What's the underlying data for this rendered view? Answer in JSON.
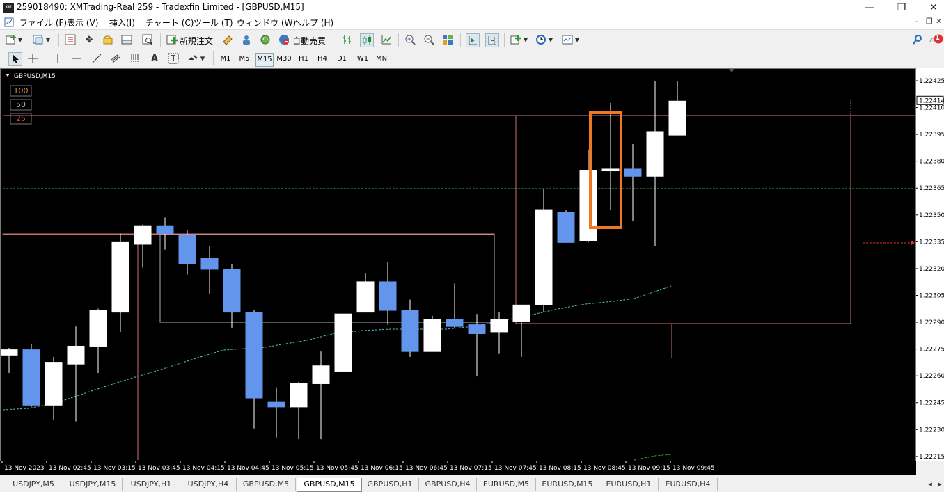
{
  "window": {
    "title": "259018490: XMTrading-Real 259 - Tradexfin Limited - [GBPUSD,M15]",
    "logo": "XM",
    "minimize": "—",
    "maximize": "❐",
    "close": "✕"
  },
  "menu": {
    "items": [
      "ファイル (F)",
      "表示 (V)",
      "挿入(I)",
      "チャート (C)",
      "ツール (T)",
      "ウィンドウ (W)",
      "ヘルプ (H)"
    ],
    "mdi_minimize": "–",
    "mdi_restore": "❐",
    "mdi_close": "✕"
  },
  "toolbar": {
    "new_order": "新規注文",
    "auto_trading": "自動売買",
    "notification_count": "1"
  },
  "timeframes": [
    "M1",
    "M5",
    "M15",
    "M30",
    "H1",
    "H4",
    "D1",
    "W1",
    "MN"
  ],
  "active_timeframe": "M15",
  "chart_data": {
    "type": "candlestick",
    "symbol_label": "GBPUSD,M15",
    "level_boxes": [
      "100",
      "50",
      "25"
    ],
    "level_colors": [
      "#e08a3a",
      "#aaaaaa",
      "#e04040"
    ],
    "current_price": "1.22414",
    "y_ticks": [
      "1.22425",
      "1.22410",
      "1.22395",
      "1.22380",
      "1.22365",
      "1.22350",
      "1.22335",
      "1.22320",
      "1.22305",
      "1.22290",
      "1.22275",
      "1.22260",
      "1.22245",
      "1.22230",
      "1.22215"
    ],
    "ylim": [
      1.22213,
      1.22432
    ],
    "x_ticks": [
      "13 Nov 2023",
      "13 Nov 02:45",
      "13 Nov 03:15",
      "13 Nov 03:45",
      "13 Nov 04:15",
      "13 Nov 04:45",
      "13 Nov 05:15",
      "13 Nov 05:45",
      "13 Nov 06:15",
      "13 Nov 06:45",
      "13 Nov 07:15",
      "13 Nov 07:45",
      "13 Nov 08:15",
      "13 Nov 08:45",
      "13 Nov 09:15",
      "13 Nov 09:45"
    ],
    "candles": [
      {
        "o": 1.22272,
        "h": 1.22276,
        "l": 1.22262,
        "c": 1.22275
      },
      {
        "o": 1.22275,
        "h": 1.22278,
        "l": 1.22243,
        "c": 1.22244
      },
      {
        "o": 1.22244,
        "h": 1.22271,
        "l": 1.22236,
        "c": 1.22268
      },
      {
        "o": 1.22267,
        "h": 1.22288,
        "l": 1.22235,
        "c": 1.22277
      },
      {
        "o": 1.22277,
        "h": 1.22298,
        "l": 1.22262,
        "c": 1.22297
      },
      {
        "o": 1.22296,
        "h": 1.2234,
        "l": 1.22285,
        "c": 1.22335
      },
      {
        "o": 1.22334,
        "h": 1.22345,
        "l": 1.22321,
        "c": 1.22344
      },
      {
        "o": 1.22344,
        "h": 1.22349,
        "l": 1.22331,
        "c": 1.2234
      },
      {
        "o": 1.22339,
        "h": 1.22342,
        "l": 1.22317,
        "c": 1.22323
      },
      {
        "o": 1.22326,
        "h": 1.22333,
        "l": 1.22306,
        "c": 1.2232
      },
      {
        "o": 1.2232,
        "h": 1.22323,
        "l": 1.22287,
        "c": 1.22296
      },
      {
        "o": 1.22296,
        "h": 1.22297,
        "l": 1.22231,
        "c": 1.22248
      },
      {
        "o": 1.22246,
        "h": 1.22254,
        "l": 1.22226,
        "c": 1.22243
      },
      {
        "o": 1.22243,
        "h": 1.22257,
        "l": 1.22225,
        "c": 1.22256
      },
      {
        "o": 1.22256,
        "h": 1.22274,
        "l": 1.22225,
        "c": 1.22266
      },
      {
        "o": 1.22263,
        "h": 1.22295,
        "l": 1.22264,
        "c": 1.22295
      },
      {
        "o": 1.22296,
        "h": 1.22318,
        "l": 1.22296,
        "c": 1.22313
      },
      {
        "o": 1.22313,
        "h": 1.22324,
        "l": 1.22289,
        "c": 1.22297
      },
      {
        "o": 1.22297,
        "h": 1.22303,
        "l": 1.22271,
        "c": 1.22274
      },
      {
        "o": 1.22274,
        "h": 1.22294,
        "l": 1.22277,
        "c": 1.22292
      },
      {
        "o": 1.22292,
        "h": 1.22312,
        "l": 1.22287,
        "c": 1.22288
      },
      {
        "o": 1.22289,
        "h": 1.22295,
        "l": 1.2226,
        "c": 1.22284
      },
      {
        "o": 1.22285,
        "h": 1.22296,
        "l": 1.22273,
        "c": 1.22292
      },
      {
        "o": 1.22291,
        "h": 1.223,
        "l": 1.22271,
        "c": 1.223
      },
      {
        "o": 1.223,
        "h": 1.22365,
        "l": 1.22296,
        "c": 1.22353
      },
      {
        "o": 1.22352,
        "h": 1.22353,
        "l": 1.22336,
        "c": 1.22335
      },
      {
        "o": 1.22336,
        "h": 1.22387,
        "l": 1.22335,
        "c": 1.22375
      },
      {
        "o": 1.22375,
        "h": 1.22413,
        "l": 1.22353,
        "c": 1.22376
      },
      {
        "o": 1.22376,
        "h": 1.2239,
        "l": 1.22347,
        "c": 1.22372
      },
      {
        "o": 1.22372,
        "h": 1.22425,
        "l": 1.22333,
        "c": 1.22397
      },
      {
        "o": 1.22395,
        "h": 1.22425,
        "l": 1.22395,
        "c": 1.22414
      }
    ],
    "colors": {
      "bull": "#ffffff",
      "bear": "#6495ed",
      "wick": "#ffffff",
      "ma": "#4fc3c8",
      "grid_dash": "#3cb043",
      "price_line": "#e07070",
      "highlight": "#f07820",
      "box_upper": "#cc7070",
      "box_lower": "#c0c0c0",
      "red_arrow": "#e03030"
    }
  },
  "tabs": [
    "USDJPY,M5",
    "USDJPY,M15",
    "USDJPY,H1",
    "USDJPY,H4",
    "GBPUSD,M5",
    "GBPUSD,M15",
    "GBPUSD,H1",
    "GBPUSD,H4",
    "EURUSD,M5",
    "EURUSD,M15",
    "EURUSD,H1",
    "EURUSD,H4"
  ],
  "active_tab": "GBPUSD,M15"
}
